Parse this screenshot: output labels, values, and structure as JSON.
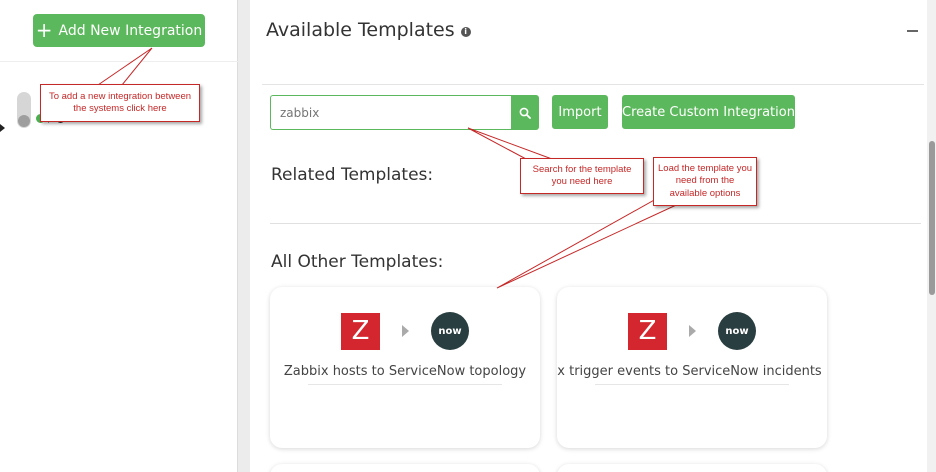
{
  "sidebar": {
    "add_button_icon": "+",
    "add_button_label": "Add New Integration"
  },
  "panel": {
    "title": "Available Templates",
    "info_icon": "i",
    "search": {
      "value": "",
      "placeholder": "zabbix"
    },
    "import_label": "Import",
    "custom_label": "Create Custom Integration",
    "related_title": "Related Templates:",
    "others_title": "All Other Templates:",
    "cards": [
      {
        "source_icon": "Z",
        "target_icon": "now",
        "label": "Zabbix hosts to ServiceNow topology"
      },
      {
        "source_icon": "Z",
        "target_icon": "now",
        "label": "Zabbix trigger events to ServiceNow incidents"
      }
    ]
  },
  "annotations": {
    "add_integration": "To add a new integration between the systems click here",
    "search_template": "Search for the template you need here",
    "load_template": "Load the template you need from the available options"
  },
  "colors": {
    "accent": "#5cb85c",
    "zabbix": "#d4262e",
    "servicenow": "#293e40",
    "annotation": "#c62828"
  }
}
